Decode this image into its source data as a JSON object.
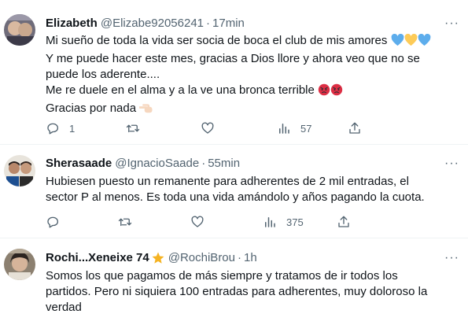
{
  "tweets": [
    {
      "name": "Elizabeth",
      "handle": "@Elizabe92056241",
      "separator": "·",
      "time": "17min",
      "more": "···",
      "lines": [
        "Mi sueño de toda la vida ser socia de boca el club de mis amores",
        "Y me puede hacer este mes, gracias a Dios llore y ahora veo que no se",
        "puede los aderente....",
        "Me re duele en el alma y a la ve una bronca terrible",
        "Gracias por nada"
      ],
      "emojis": {
        "line1": [
          "blue-heart-icon",
          "yellow-heart-icon",
          "blue-heart-icon"
        ],
        "line4": [
          "angry-face-icon",
          "angry-face-icon"
        ],
        "line5": [
          "pointing-hand-icon"
        ]
      },
      "replies": "1",
      "retweets": "",
      "likes": "",
      "views": "57"
    },
    {
      "name": "Sherasaade",
      "handle": "@IgnacioSaade",
      "separator": "·",
      "time": "55min",
      "more": "···",
      "lines": [
        "Hubiesen puesto un remanente para adherentes de 2 mil entradas, el",
        "sector P al menos. Es toda una vida amándolo y años pagando la cuota."
      ],
      "replies": "",
      "retweets": "",
      "likes": "",
      "views": "375"
    },
    {
      "name": "Rochi...Xeneixe 74",
      "handle": "@RochiBrou",
      "separator": "·",
      "time": "1h",
      "more": "···",
      "lines": [
        "Somos los que pagamos de más siempre y tratamos de ir todos los",
        "partidos. Pero ni siquiera 100 entradas para adherentes, muy doloroso la",
        "verdad"
      ]
    }
  ],
  "colors": {
    "text": "#0f1419",
    "secondary": "#536471",
    "divider": "#eff3f4",
    "star": "#f5b323"
  }
}
